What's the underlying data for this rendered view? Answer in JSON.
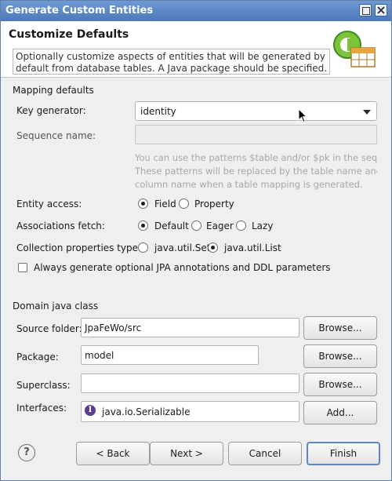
{
  "window": {
    "title": "Generate Custom Entities"
  },
  "header": {
    "title": "Customize Defaults",
    "description_line1": "Optionally customize aspects of entities that will be generated by",
    "description_line2": "default from database tables. A Java package should be specified."
  },
  "mapping": {
    "section_label": "Mapping defaults",
    "key_generator_label": "Key generator:",
    "key_generator_value": "identity",
    "sequence_label": "Sequence name:",
    "sequence_value": "",
    "hint_line1": "You can use the patterns $table and/or $pk in the seque",
    "hint_line2": "These patterns will be replaced by the table name and t",
    "hint_line3": "column name when a table mapping is generated.",
    "entity_access_label": "Entity access:",
    "entity_access_options": [
      "Field",
      "Property"
    ],
    "entity_access_selected": "Field",
    "assoc_fetch_label": "Associations fetch:",
    "assoc_fetch_options": [
      "Default",
      "Eager",
      "Lazy"
    ],
    "assoc_fetch_selected": "Default",
    "collection_label": "Collection properties type:",
    "collection_options": [
      "java.util.Set",
      "java.util.List"
    ],
    "collection_selected": "java.util.List",
    "always_generate_label": "Always generate optional JPA annotations and DDL parameters",
    "always_generate_checked": false
  },
  "domain": {
    "section_label": "Domain java class",
    "source_folder_label": "Source folder:",
    "source_folder_value": "JpaFeWo/src",
    "package_label": "Package:",
    "package_value": "model",
    "superclass_label": "Superclass:",
    "superclass_value": "",
    "interfaces_label": "Interfaces:",
    "interfaces": [
      "java.io.Serializable"
    ],
    "browse_label": "Browse...",
    "add_label": "Add..."
  },
  "footer": {
    "help_icon": "?",
    "back_label": "< Back",
    "next_label": "Next >",
    "cancel_label": "Cancel",
    "finish_label": "Finish"
  },
  "colors": {
    "titlebar": "#4c79b8",
    "default_button_border": "#5b86c7",
    "hint_text": "#a7a7a7"
  },
  "icons": {
    "window_minimize": "minimize-icon",
    "window_close": "close-icon",
    "wizard_banner": "jpa-entity-wizard-icon",
    "interface": "interface-icon",
    "help": "help-icon",
    "mouse_cursor": "arrow-cursor-icon"
  }
}
